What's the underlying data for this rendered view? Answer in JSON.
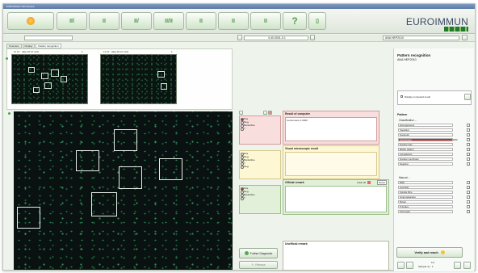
{
  "window": {
    "title": "EUROPattern Microscope"
  },
  "toolbar": {
    "buttons": [
      {
        "icon": "sun-icon"
      },
      {
        "icon": "plate-icon-1",
        "label": "IIl"
      },
      {
        "icon": "plate-icon-2",
        "label": "II"
      },
      {
        "icon": "plate-icon-3",
        "label": "II/"
      },
      {
        "icon": "plate-icon-4",
        "label": "II/II"
      },
      {
        "icon": "plate-icon-5",
        "label": "II"
      },
      {
        "icon": "plate-icon-6",
        "label": "II"
      },
      {
        "icon": "plate-icon-7",
        "label": "II"
      },
      {
        "icon": "help-icon",
        "label": "?"
      },
      {
        "icon": "exit-icon",
        "label": "▯"
      }
    ],
    "logo": "EUROIMMUN"
  },
  "nav": {
    "left_field": "",
    "center_field": "0.40.0001-0.1",
    "right_field": "ANA HEP2010"
  },
  "tabs": [
    "Overview",
    "Display",
    "Pattern recognition"
  ],
  "thumbnails": [
    {
      "caption": "11 10 · HEp-20 10 cells",
      "index": "1"
    },
    {
      "caption": "11 10 · HEp-20 10 cells",
      "index": "1"
    }
  ],
  "panels": {
    "group1": {
      "options": [
        "Pos.",
        "Neg.",
        "Borderline",
        "?"
      ],
      "selected": 0
    },
    "group2": {
      "options": [
        "Pos.",
        "Neg.",
        "Borderline",
        "?",
        "Neg."
      ],
      "selected": -1
    },
    "group3": {
      "options": [
        "Pos.",
        "Neg.",
        "Borderline",
        "?"
      ],
      "selected": 0
    },
    "result_computer": {
      "title": "Result of computer",
      "text": "Centromere 1:3200"
    },
    "visual_result": {
      "title": "Visual microscopic result"
    },
    "official_remark": {
      "title": "Official remark",
      "clear_all": "Clear all",
      "reset": "Reset"
    },
    "unofficial_remark": {
      "title": "Unofficial remark"
    }
  },
  "bottom_buttons": {
    "further": "Further Diagnostic",
    "release": "Release"
  },
  "right": {
    "title": "Pattern recognition",
    "subtitle": "ANA HEP2010",
    "display_check": "Display computed result",
    "pattern_label": "Pattern",
    "classifier_label": "Classification ...",
    "classifier_items": [
      "Homogeneous",
      "Speckled",
      "Nucleolar",
      "Centromere",
      "Nuclear dots",
      "Mitotic pattern",
      "Cytoplasmic",
      "Nuclear membrane",
      "Negative"
    ],
    "highlight_index": 3,
    "highlight_value": "1:3200",
    "manual_label": "Manual ...",
    "manual_items": [
      "RNP",
      "Centriole",
      "Spindle fibre",
      "Golgi apparatus",
      "Mitotic",
      "P-bodies",
      "Chromatin"
    ],
    "verify_button": "Verify and reach",
    "sample_label": "Sample no.: 1",
    "page": "1/1"
  },
  "colors": {
    "accent": "#4a9a46",
    "highlight": "#c0302a",
    "pink_panel": "#f9dede",
    "yellow_panel": "#fdf7d4",
    "green_panel": "#e2f0d9"
  }
}
